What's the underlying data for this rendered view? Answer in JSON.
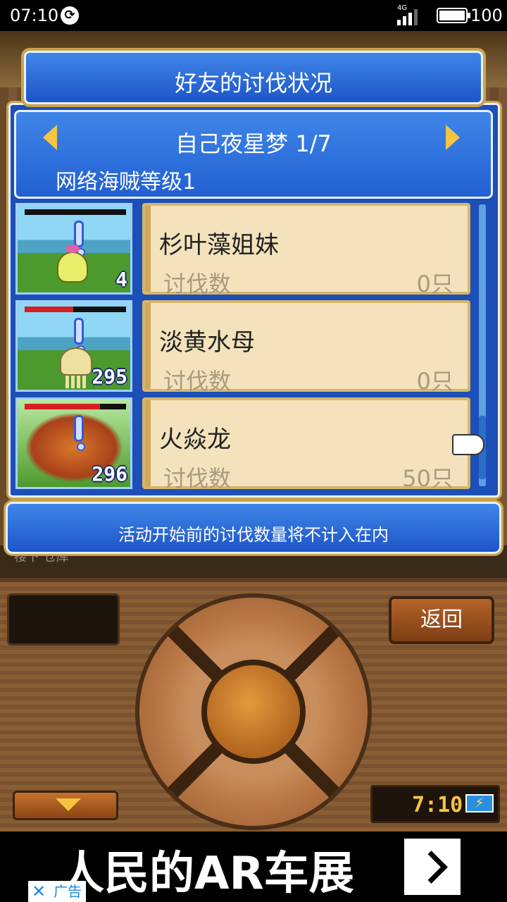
{
  "status_bar": {
    "time": "07:10",
    "network": "4G",
    "battery": "100"
  },
  "dialog": {
    "title": "好友的讨伐状况",
    "friend_name": "自己夜星梦 1/7",
    "pirate_level": "网络海贼等级1",
    "notice": "活动开始前的讨伐数量将不计入在内"
  },
  "monsters": [
    {
      "name": "杉叶藻姐妹",
      "kill_label": "讨伐数",
      "kill_value": "0只",
      "count": "4",
      "hp_ratio": 0.0
    },
    {
      "name": "淡黄水母",
      "kill_label": "讨伐数",
      "kill_value": "0只",
      "count": "295",
      "hp_ratio": 0.48
    },
    {
      "name": "火焱龙",
      "kill_label": "讨伐数",
      "kill_value": "50只",
      "count": "296",
      "hp_ratio": 0.74
    }
  ],
  "background_caption": "楼下 仓库",
  "controller": {
    "back_label": "返回",
    "clock": "7:10",
    "charging_icon": "⚡"
  },
  "ad": {
    "text": "人民的AR车展",
    "close_icon": "✕",
    "label": "广告"
  }
}
